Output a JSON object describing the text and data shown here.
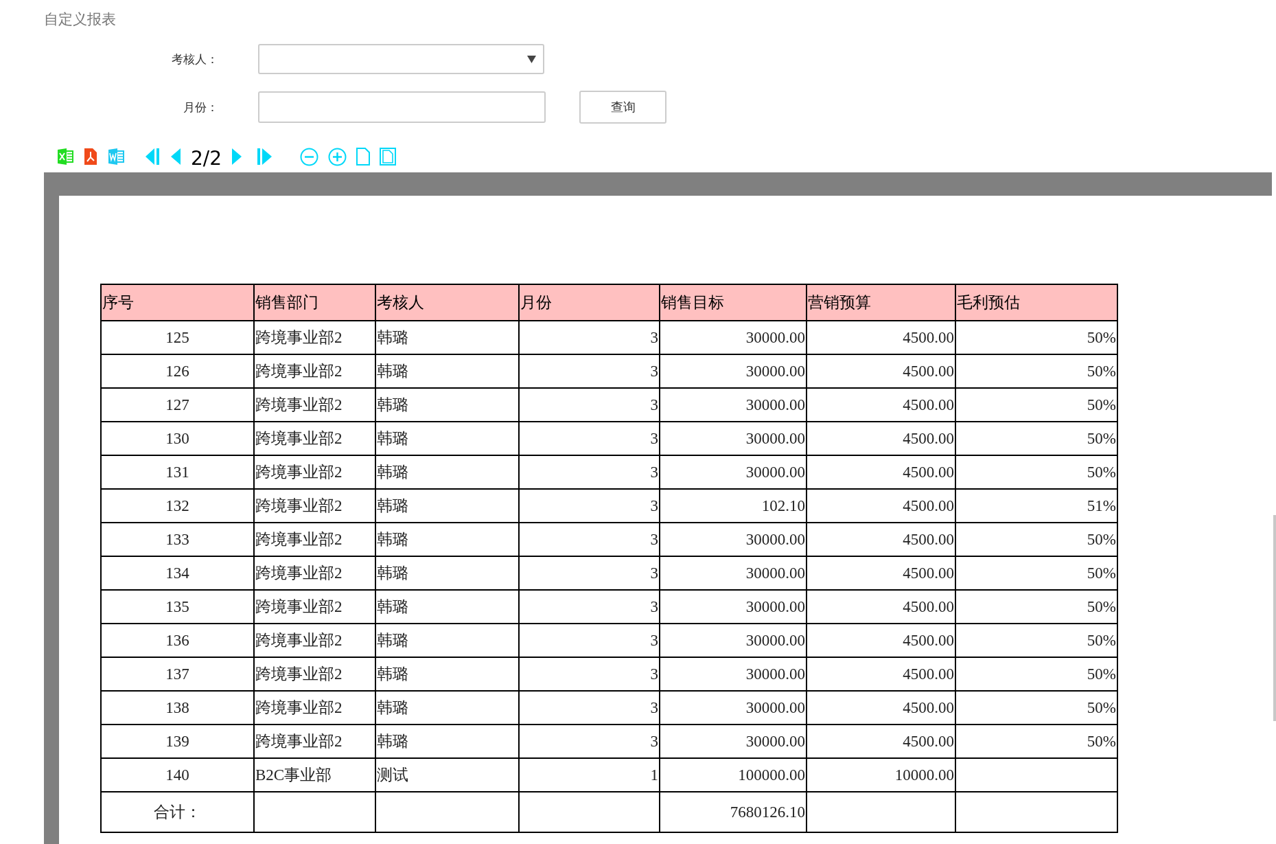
{
  "title": "自定义报表",
  "filters": [
    {
      "kind": "select",
      "label": "考核人："
    },
    {
      "kind": "text",
      "label": "月份："
    }
  ],
  "query_button": "查询",
  "toolbar": {
    "page_indicator": "2/2"
  },
  "table": {
    "columns": [
      "序号",
      "销售部门",
      "考核人",
      "月份",
      "销售目标",
      "营销预算",
      "毛利预估"
    ],
    "rows": [
      [
        "125",
        "跨境事业部2",
        "韩璐",
        "3",
        "30000.00",
        "4500.00",
        "50%"
      ],
      [
        "126",
        "跨境事业部2",
        "韩璐",
        "3",
        "30000.00",
        "4500.00",
        "50%"
      ],
      [
        "127",
        "跨境事业部2",
        "韩璐",
        "3",
        "30000.00",
        "4500.00",
        "50%"
      ],
      [
        "130",
        "跨境事业部2",
        "韩璐",
        "3",
        "30000.00",
        "4500.00",
        "50%"
      ],
      [
        "131",
        "跨境事业部2",
        "韩璐",
        "3",
        "30000.00",
        "4500.00",
        "50%"
      ],
      [
        "132",
        "跨境事业部2",
        "韩璐",
        "3",
        "102.10",
        "4500.00",
        "51%"
      ],
      [
        "133",
        "跨境事业部2",
        "韩璐",
        "3",
        "30000.00",
        "4500.00",
        "50%"
      ],
      [
        "134",
        "跨境事业部2",
        "韩璐",
        "3",
        "30000.00",
        "4500.00",
        "50%"
      ],
      [
        "135",
        "跨境事业部2",
        "韩璐",
        "3",
        "30000.00",
        "4500.00",
        "50%"
      ],
      [
        "136",
        "跨境事业部2",
        "韩璐",
        "3",
        "30000.00",
        "4500.00",
        "50%"
      ],
      [
        "137",
        "跨境事业部2",
        "韩璐",
        "3",
        "30000.00",
        "4500.00",
        "50%"
      ],
      [
        "138",
        "跨境事业部2",
        "韩璐",
        "3",
        "30000.00",
        "4500.00",
        "50%"
      ],
      [
        "139",
        "跨境事业部2",
        "韩璐",
        "3",
        "30000.00",
        "4500.00",
        "50%"
      ],
      [
        "140",
        "B2C事业部",
        "测试",
        "1",
        "100000.00",
        "10000.00",
        null
      ]
    ],
    "total_row": {
      "label": "合计：",
      "sales_target": "7680126.10"
    }
  }
}
